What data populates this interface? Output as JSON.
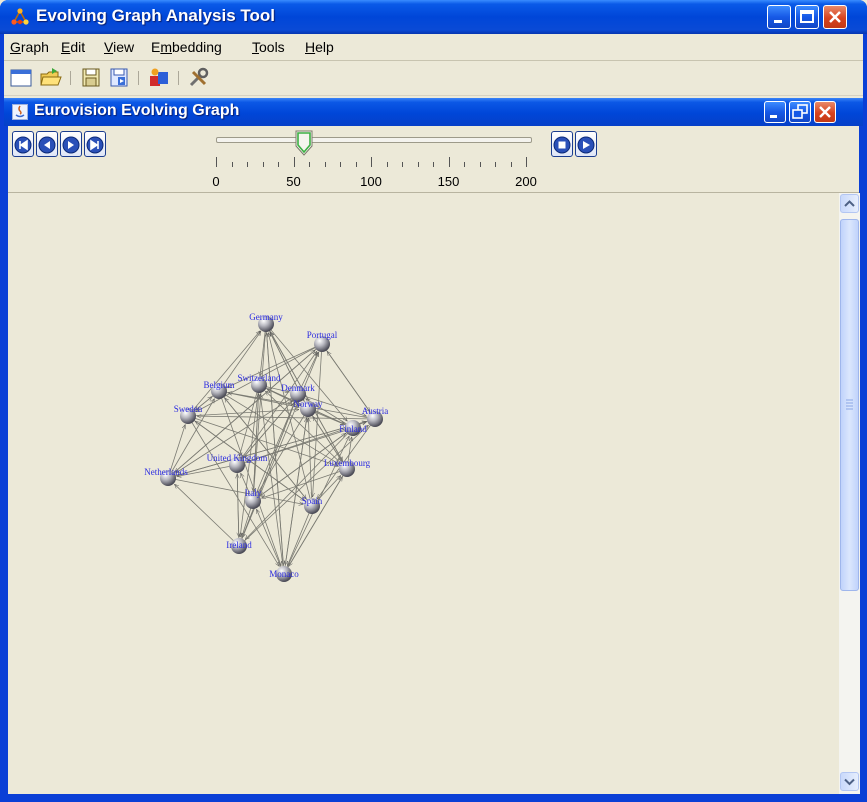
{
  "window": {
    "title": "Evolving Graph Analysis Tool"
  },
  "menu": [
    {
      "label": "Graph",
      "mnemonic": "G",
      "rest": "raph"
    },
    {
      "label": "Edit",
      "mnemonic": "E",
      "rest": "dit"
    },
    {
      "label": "View",
      "mnemonic": "V",
      "rest": "iew"
    },
    {
      "label": "Embedding",
      "pre": "E",
      "mnemonic": "m",
      "rest": "bedding"
    },
    {
      "label": "Tools",
      "mnemonic": "T",
      "rest": "ools"
    },
    {
      "label": "Help",
      "mnemonic": "H",
      "rest": "elp"
    }
  ],
  "toolbar": {
    "icons": [
      "new-window-icon",
      "open-folder-icon",
      "save-icon",
      "save-as-icon",
      "embedding-icon",
      "tools-icon"
    ]
  },
  "inner_window": {
    "title": "Eurovision Evolving Graph"
  },
  "timeline": {
    "min": 0,
    "max": 200,
    "value": 57,
    "tick_labels": [
      "0",
      "50",
      "100",
      "150",
      "200"
    ]
  },
  "playback": {
    "left_buttons": [
      "first-frame-icon",
      "step-back-icon",
      "step-forward-icon",
      "last-frame-icon"
    ],
    "right_buttons": [
      "stop-icon",
      "play-icon"
    ]
  },
  "graph": {
    "nodes": [
      {
        "id": "Germany",
        "label": "Germany"
      },
      {
        "id": "Portugal",
        "label": "Portugal"
      },
      {
        "id": "Switzerland",
        "label": "Switzerland"
      },
      {
        "id": "Belgium",
        "label": "Belgium"
      },
      {
        "id": "Denmark",
        "label": "Denmark"
      },
      {
        "id": "Norway",
        "label": "Norway"
      },
      {
        "id": "Austria",
        "label": "Austria"
      },
      {
        "id": "Finland",
        "label": "Finland"
      },
      {
        "id": "Sweden",
        "label": "Sweden"
      },
      {
        "id": "United Kingdom",
        "label": "United Kingdom"
      },
      {
        "id": "Luxembourg",
        "label": "Luxembourg"
      },
      {
        "id": "Netherlands",
        "label": "Netherlands"
      },
      {
        "id": "Italy",
        "label": "Italy"
      },
      {
        "id": "Spain",
        "label": "Spain"
      },
      {
        "id": "Ireland",
        "label": "Ireland"
      },
      {
        "id": "Monaco",
        "label": "Monaco"
      }
    ]
  }
}
